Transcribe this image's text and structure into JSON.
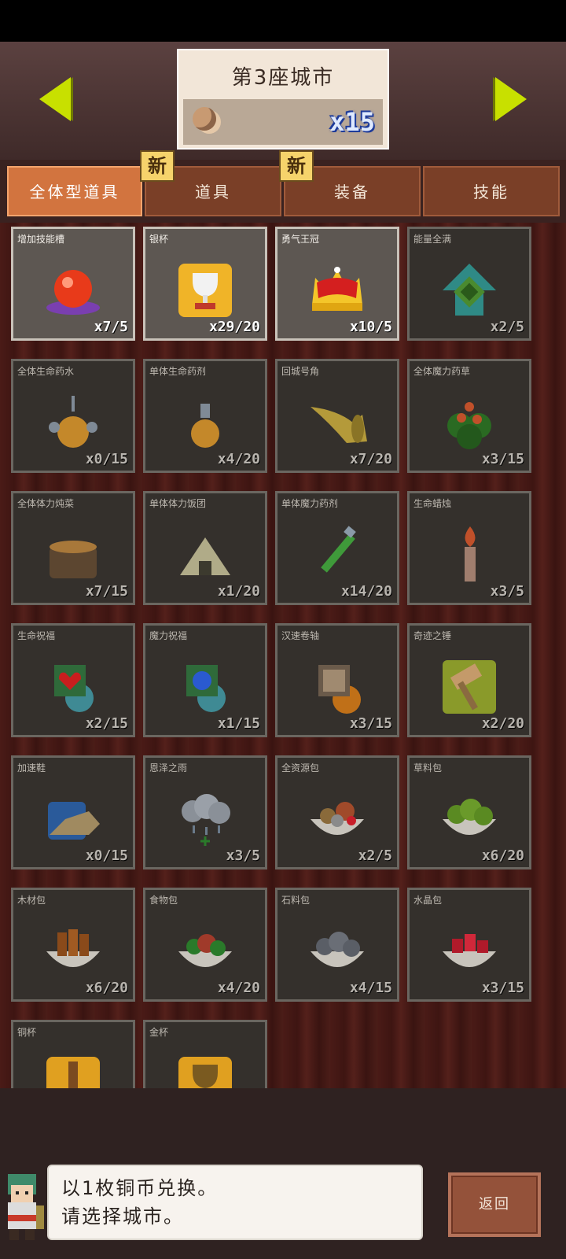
{
  "header": {
    "city_title": "第3座城市",
    "coin_count": "x15",
    "prev_icon": "arrow-left-icon",
    "next_icon": "arrow-right-icon"
  },
  "tabs": [
    {
      "label": "全体型道具",
      "active": true,
      "badge": ""
    },
    {
      "label": "道具",
      "active": false,
      "badge": "新"
    },
    {
      "label": "装备",
      "active": false,
      "badge": "新"
    },
    {
      "label": "技能",
      "active": false,
      "badge": ""
    }
  ],
  "items": [
    {
      "name": "增加技能槽",
      "count": "x7/5",
      "owned": true,
      "icon": "orb-icon"
    },
    {
      "name": "银杯",
      "count": "x29/20",
      "owned": true,
      "icon": "silver-cup-icon"
    },
    {
      "name": "勇气王冠",
      "count": "x10/5",
      "owned": true,
      "icon": "crown-icon"
    },
    {
      "name": "能量全满",
      "count": "x2/5",
      "owned": false,
      "icon": "energy-up-icon"
    },
    {
      "name": "全体生命药水",
      "count": "x0/15",
      "owned": false,
      "icon": "potion-icon"
    },
    {
      "name": "单体生命药剂",
      "count": "x4/20",
      "owned": false,
      "icon": "potion-small-icon"
    },
    {
      "name": "回城号角",
      "count": "x7/20",
      "owned": false,
      "icon": "horn-icon"
    },
    {
      "name": "全体魔力药草",
      "count": "x3/15",
      "owned": false,
      "icon": "herb-icon"
    },
    {
      "name": "全体体力炖菜",
      "count": "x7/15",
      "owned": false,
      "icon": "pot-icon"
    },
    {
      "name": "单体体力饭团",
      "count": "x1/20",
      "owned": false,
      "icon": "riceball-icon"
    },
    {
      "name": "单体魔力药剂",
      "count": "x14/20",
      "owned": false,
      "icon": "vial-icon"
    },
    {
      "name": "生命蜡烛",
      "count": "x3/5",
      "owned": false,
      "icon": "candle-icon"
    },
    {
      "name": "生命祝福",
      "count": "x2/15",
      "owned": false,
      "icon": "heart-blessing-icon"
    },
    {
      "name": "魔力祝福",
      "count": "x1/15",
      "owned": false,
      "icon": "mana-blessing-icon"
    },
    {
      "name": "汉速卷轴",
      "count": "x3/15",
      "owned": false,
      "icon": "scroll-icon"
    },
    {
      "name": "奇迹之锤",
      "count": "x2/20",
      "owned": false,
      "icon": "hammer-icon"
    },
    {
      "name": "加速鞋",
      "count": "x0/15",
      "owned": false,
      "icon": "shoe-icon"
    },
    {
      "name": "恩泽之雨",
      "count": "x3/5",
      "owned": false,
      "icon": "raincloud-icon"
    },
    {
      "name": "全资源包",
      "count": "x2/5",
      "owned": false,
      "icon": "resource-bowl-icon"
    },
    {
      "name": "草料包",
      "count": "x6/20",
      "owned": false,
      "icon": "grass-bowl-icon"
    },
    {
      "name": "木材包",
      "count": "x6/20",
      "owned": false,
      "icon": "wood-bowl-icon"
    },
    {
      "name": "食物包",
      "count": "x4/20",
      "owned": false,
      "icon": "food-bowl-icon"
    },
    {
      "name": "石料包",
      "count": "x4/15",
      "owned": false,
      "icon": "stone-bowl-icon"
    },
    {
      "name": "水晶包",
      "count": "x3/15",
      "owned": false,
      "icon": "crystal-bowl-icon"
    },
    {
      "name": "铜杯",
      "count": "",
      "owned": false,
      "icon": "copper-cup-icon"
    },
    {
      "name": "金杯",
      "count": "",
      "owned": false,
      "icon": "gold-cup-icon"
    }
  ],
  "dialog": {
    "line1": "以1枚铜币兑换。",
    "line2": "请选择城市。"
  },
  "back_button": "返回",
  "colors": {
    "accent_arrow": "#c8e000",
    "active_tab": "#d2743f",
    "coin_text": "#dfeaff"
  }
}
